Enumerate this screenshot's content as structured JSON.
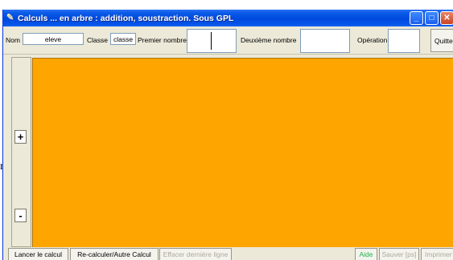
{
  "window": {
    "title": "Calculs ... en arbre : addition, soustraction. Sous GPL",
    "icon": "quill-icon",
    "controls": {
      "minimize": "_",
      "maximize": "□",
      "close": "✕"
    }
  },
  "topbar": {
    "nom_label": "Nom",
    "nom_value": "eleve",
    "classe_label": "Classe",
    "classe_value": "classe",
    "premier_label": "Premier nombre",
    "premier_value": "",
    "deuxieme_label": "Deuxième nombre",
    "deuxieme_value": "",
    "operation_label": "Opération",
    "operation_value": "",
    "quit_label": "Quitter"
  },
  "side": {
    "plus_label": "+",
    "minus_label": "-"
  },
  "outside_text": "n",
  "canvas": {
    "color": "#ffa500"
  },
  "bottombar": {
    "lancer_label": "Lancer le calcul",
    "recalculer_label": "Re-calculer/Autre Calcul",
    "effacer_label": "Effacer dernière ligne",
    "aide_label": "Aide",
    "sauver_label": "Sauver [ps]",
    "imprimer_label": "Imprimer"
  }
}
